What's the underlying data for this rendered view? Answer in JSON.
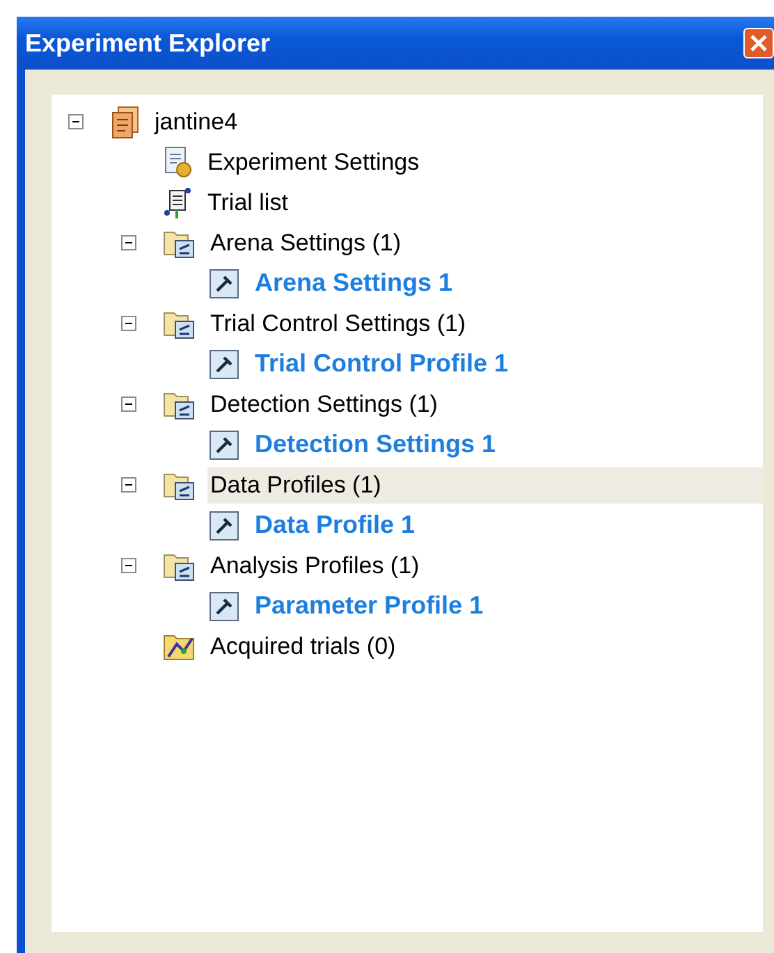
{
  "window": {
    "title": "Experiment Explorer"
  },
  "tree": [
    {
      "label": "jantine4",
      "kind": "experiment",
      "expanded": true,
      "selected": false,
      "children": [
        {
          "label": "Experiment Settings",
          "kind": "settings",
          "selected": false
        },
        {
          "label": "Trial list",
          "kind": "triallist",
          "selected": false
        },
        {
          "label": "Arena Settings (1)",
          "kind": "folder",
          "expanded": true,
          "selected": false,
          "children": [
            {
              "label": "Arena Settings 1",
              "kind": "profile",
              "selected": false
            }
          ]
        },
        {
          "label": "Trial Control Settings (1)",
          "kind": "folder",
          "expanded": true,
          "selected": false,
          "children": [
            {
              "label": "Trial Control Profile 1",
              "kind": "profile",
              "selected": false
            }
          ]
        },
        {
          "label": "Detection Settings (1)",
          "kind": "folder",
          "expanded": true,
          "selected": false,
          "children": [
            {
              "label": "Detection Settings 1",
              "kind": "profile",
              "selected": false
            }
          ]
        },
        {
          "label": "Data Profiles (1)",
          "kind": "folder",
          "expanded": true,
          "selected": true,
          "children": [
            {
              "label": "Data Profile 1",
              "kind": "profile",
              "selected": false
            }
          ]
        },
        {
          "label": "Analysis Profiles (1)",
          "kind": "folder",
          "expanded": true,
          "selected": false,
          "children": [
            {
              "label": "Parameter Profile 1",
              "kind": "profile",
              "selected": false
            }
          ]
        },
        {
          "label": "Acquired trials (0)",
          "kind": "acquired",
          "selected": false
        }
      ]
    }
  ]
}
